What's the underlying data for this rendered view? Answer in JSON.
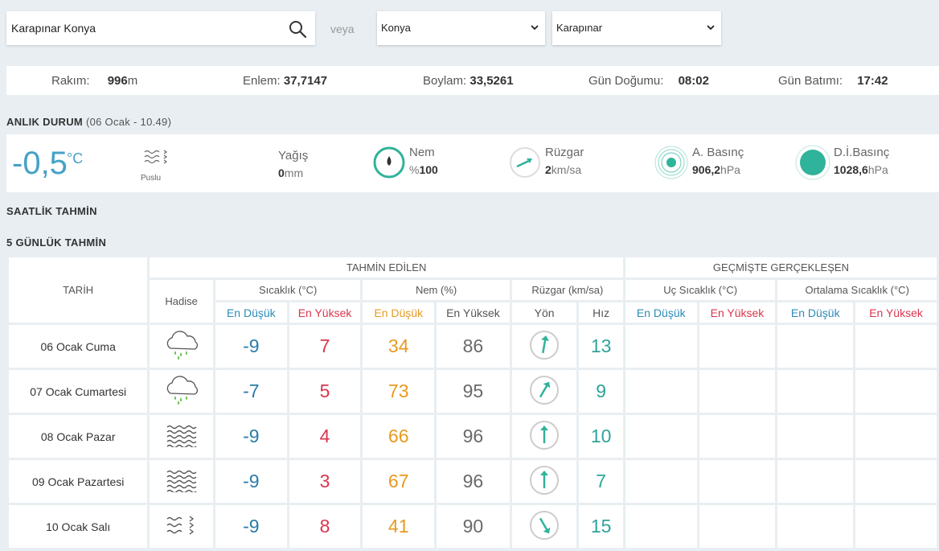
{
  "search": {
    "value": "Karapınar Konya",
    "icon": "search-icon"
  },
  "veya": "veya",
  "province_select": {
    "selected": "Konya"
  },
  "district_select": {
    "selected": "Karapınar"
  },
  "location_info": {
    "rakim_label": "Rakım:",
    "rakim_value": "996",
    "rakim_unit": "m",
    "enlem_label": "Enlem:",
    "enlem_value": "37,7147",
    "boylam_label": "Boylam:",
    "boylam_value": "33,5261",
    "gun_dogumu_label": "Gün Doğumu:",
    "gun_dogumu_value": "08:02",
    "gun_batimi_label": "Gün Batımı:",
    "gun_batimi_value": "17:42"
  },
  "current": {
    "heading": "ANLIK DURUM",
    "heading_time": "(06 Ocak - 10.49)",
    "temperature": "-0,5",
    "temperature_unit": "°C",
    "condition_icon": "fog-icon",
    "condition": "Puslu",
    "precip_label": "Yağış",
    "precip_value": "0",
    "precip_unit": "mm",
    "humidity_label": "Nem",
    "humidity_prefix": "%",
    "humidity_value": "100",
    "wind_label": "Rüzgar",
    "wind_value": "2",
    "wind_unit": "km/sa",
    "pressure_label": "A. Basınç",
    "pressure_value": "906,2",
    "pressure_unit": "hPa",
    "sea_pressure_label": "D.İ.Basınç",
    "sea_pressure_value": "1028,6",
    "sea_pressure_unit": "hPa"
  },
  "hourly_heading": "SAATLİK TAHMİN",
  "daily_heading": "5 GÜNLÜK TAHMİN",
  "table": {
    "tarih": "TARİH",
    "tahmin_edilen": "TAHMİN EDİLEN",
    "gecmiste": "GEÇMİŞTE GERÇEKLEŞEN",
    "hadise": "Hadise",
    "sicaklik": "Sıcaklık (°C)",
    "nem": "Nem (%)",
    "ruzgar": "Rüzgar (km/sa)",
    "uc_sicaklik": "Uç Sıcaklık (°C)",
    "ortalama_sicaklik": "Ortalama Sıcaklık (°C)",
    "en_dusuk": "En Düşük",
    "en_yuksek": "En Yüksek",
    "yon": "Yön",
    "hiz": "Hız"
  },
  "colors": {
    "accent": "#2fb39a",
    "min": "#2b7ca8",
    "max": "#d9364e",
    "humidity_min": "#e89a1f"
  },
  "days": [
    {
      "date": "06 Ocak Cuma",
      "icon": "rain-cloud-icon",
      "min": "-9",
      "max": "7",
      "hmin": "34",
      "hmax": "86",
      "wind_dir_deg": 190,
      "speed": "13"
    },
    {
      "date": "07 Ocak Cumartesi",
      "icon": "rain-cloud-icon",
      "min": "-7",
      "max": "5",
      "hmin": "73",
      "hmax": "95",
      "wind_dir_deg": 210,
      "speed": "9"
    },
    {
      "date": "08 Ocak Pazar",
      "icon": "fog-icon",
      "min": "-9",
      "max": "4",
      "hmin": "66",
      "hmax": "96",
      "wind_dir_deg": 180,
      "speed": "10"
    },
    {
      "date": "09 Ocak Pazartesi",
      "icon": "fog-icon",
      "min": "-9",
      "max": "3",
      "hmin": "67",
      "hmax": "96",
      "wind_dir_deg": 180,
      "speed": "7"
    },
    {
      "date": "10 Ocak Salı",
      "icon": "haze-icon",
      "min": "-9",
      "max": "8",
      "hmin": "41",
      "hmax": "90",
      "wind_dir_deg": 330,
      "speed": "15"
    }
  ]
}
